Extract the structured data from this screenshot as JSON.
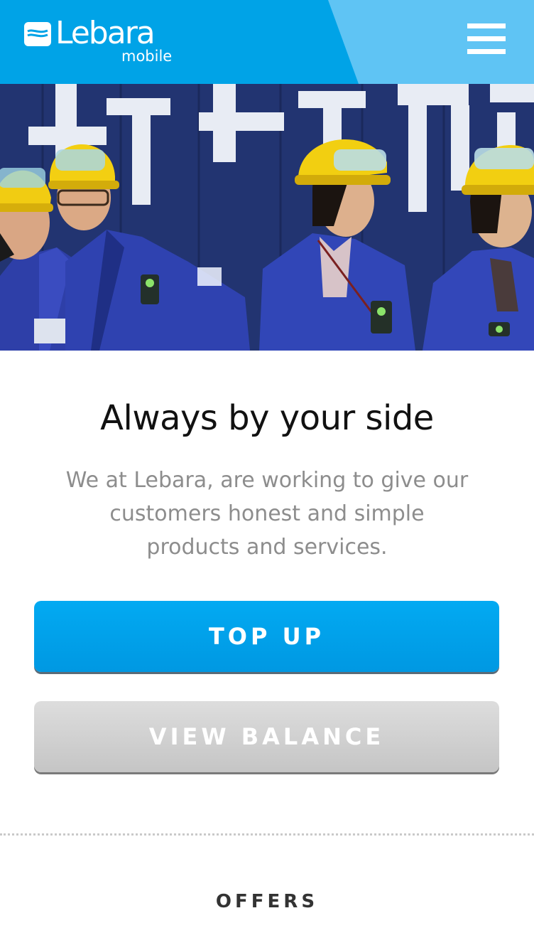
{
  "header": {
    "brand_name": "Lebara",
    "brand_sub": "mobile",
    "menu_icon": "hamburger-menu-icon",
    "colors": {
      "primary": "#00a3e7",
      "light": "#5fc4f4"
    }
  },
  "hero": {
    "image_alt": "Workers in blue uniforms and yellow hard hats"
  },
  "main": {
    "headline": "Always by your side",
    "intro": "We at Lebara, are working to give our customers honest and simple products and services.",
    "top_up_label": "TOP UP",
    "view_balance_label": "VIEW BALANCE",
    "offers_heading": "OFFERS"
  },
  "colors": {
    "top_up_button": "#00a3ee",
    "view_balance_button": "#cfcfcf",
    "intro_text": "#8d8d8d"
  }
}
